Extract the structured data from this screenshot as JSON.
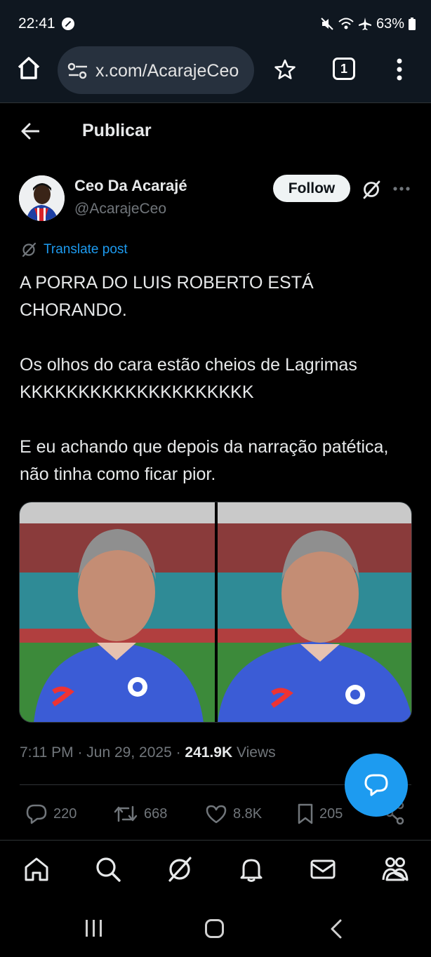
{
  "status_bar": {
    "time": "22:41",
    "battery": "63%"
  },
  "browser": {
    "url": "x.com/AcarajeCeo",
    "tab_count": "1"
  },
  "header": {
    "title": "Publicar"
  },
  "author": {
    "name": "Ceo Da Acarajé",
    "handle": "@AcarajeCeo",
    "follow_label": "Follow"
  },
  "post": {
    "translate_label": "Translate post",
    "paragraphs": [
      "A PORRA DO LUIS ROBERTO ESTÁ CHORANDO.",
      "Os olhos do cara estão cheios de Lagrimas KKKKKKKKKKKKKKKKKKKK",
      "E eu achando que depois da narração patética, não tinha como ficar pior."
    ],
    "time": "7:11 PM · Jun 29, 2025 · ",
    "views_count": "241.9K",
    "views_label": "Views"
  },
  "actions": {
    "replies": "220",
    "reposts": "668",
    "likes": "8.8K",
    "bookmarks": "205"
  },
  "colors": {
    "accent": "#1d9bf0",
    "background": "#000000",
    "toolbar": "#0f1720"
  }
}
